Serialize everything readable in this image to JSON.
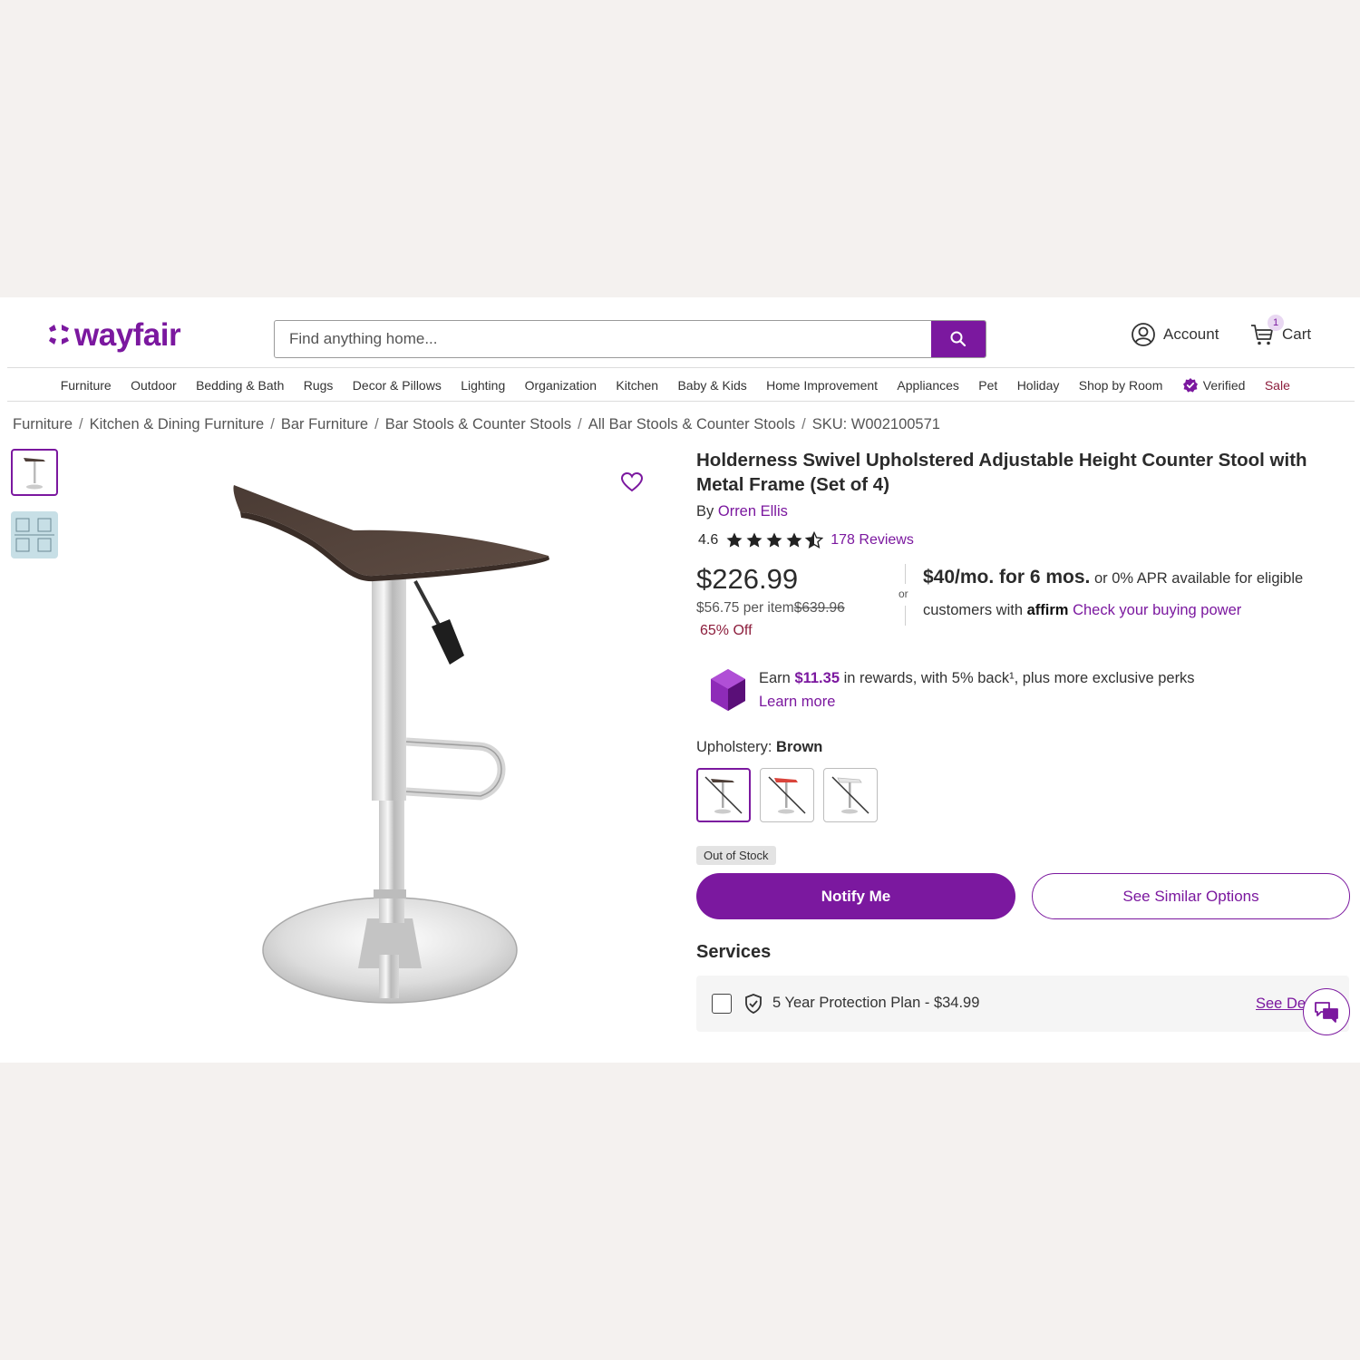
{
  "header": {
    "logo_text": "wayfair",
    "search_placeholder": "Find anything home...",
    "account_label": "Account",
    "cart_label": "Cart",
    "cart_count": "1"
  },
  "nav": {
    "items": [
      "Furniture",
      "Outdoor",
      "Bedding & Bath",
      "Rugs",
      "Decor & Pillows",
      "Lighting",
      "Organization",
      "Kitchen",
      "Baby & Kids",
      "Home Improvement",
      "Appliances",
      "Pet",
      "Holiday",
      "Shop by Room"
    ],
    "verified_label": "Verified",
    "sale_label": "Sale"
  },
  "breadcrumbs": [
    "Furniture",
    "Kitchen & Dining Furniture",
    "Bar Furniture",
    "Bar Stools & Counter Stools",
    "All Bar Stools & Counter Stools",
    "SKU: W002100571"
  ],
  "product": {
    "title": "Holderness Swivel Upholstered Adjustable Height Counter Stool with Metal Frame (Set of 4)",
    "by_label": "By",
    "brand": "Orren Ellis",
    "rating_value": "4.6",
    "rating_stars": 4.6,
    "reviews_label": "178 Reviews",
    "price": "$226.99",
    "per_item": "$56.75 per item",
    "original_price": "$639.96",
    "discount": "65% Off"
  },
  "financing": {
    "or_label": "or",
    "monthly": "$40/mo. for 6 mos.",
    "line1_rest": " or 0% APR available for eligible",
    "line2_prefix": "customers with ",
    "affirm": "affirm",
    "buying_power_link": "Check your buying power"
  },
  "rewards": {
    "prefix": "Earn ",
    "amount": "$11.35",
    "suffix": " in rewards, with 5% back¹, plus more exclusive perks",
    "learn_more": "Learn more"
  },
  "options": {
    "label": "Upholstery: ",
    "selected": "Brown"
  },
  "stock_badge": "Out of Stock",
  "buttons": {
    "notify": "Notify Me",
    "similar": "See Similar Options"
  },
  "services": {
    "heading": "Services",
    "plan": "5 Year Protection Plan - $34.99",
    "details_link": "See Details"
  },
  "colors": {
    "brand_purple": "#7b189f",
    "sale_red": "#8c1d3c"
  }
}
